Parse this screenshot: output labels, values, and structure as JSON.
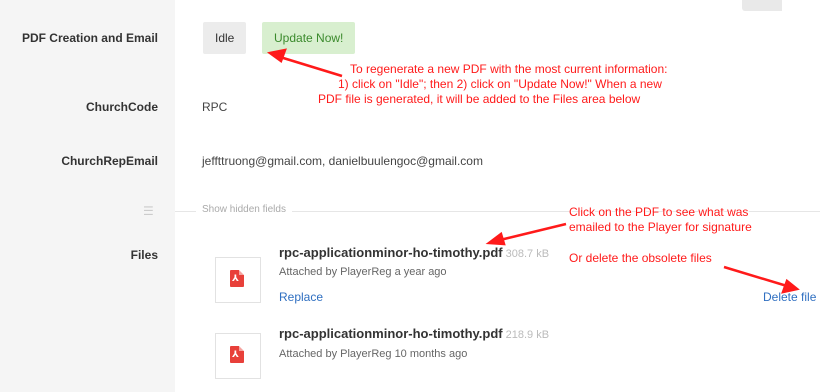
{
  "form": {
    "pdf_creation": {
      "label": "PDF Creation and Email",
      "idle_button": "Idle",
      "update_button": "Update Now!"
    },
    "church_code": {
      "label": "ChurchCode",
      "value": "RPC"
    },
    "church_rep_email": {
      "label": "ChurchRepEmail",
      "value": "jeffttruong@gmail.com, danielbuulengoc@gmail.com"
    },
    "hidden_fields_link": "Show hidden fields",
    "files": {
      "label": "Files",
      "items": [
        {
          "name": "rpc-applicationminor-ho-timothy.pdf",
          "size": "308.7 kB",
          "attached": "Attached by PlayerReg a year ago",
          "replace": "Replace",
          "delete": "Delete file"
        },
        {
          "name": "rpc-applicationminor-ho-timothy.pdf",
          "size": "218.9 kB",
          "attached": "Attached by PlayerReg 10 months ago"
        }
      ]
    }
  },
  "annotations": {
    "regenerate": [
      "To regenerate a new PDF with the most current information:",
      "1) click on \"Idle\"; then 2) click on \"Update Now!\" When a new",
      "PDF file is generated, it will be added to the Files area below"
    ],
    "click_pdf": [
      "Click on the PDF to see what was",
      "emailed to the Player for signature"
    ],
    "delete": "Or delete the obsolete files"
  },
  "colors": {
    "annotation": "#ff1a1a",
    "link": "#2f6fc1",
    "update_bg": "#d8efcf",
    "update_text": "#3b8a2c"
  }
}
